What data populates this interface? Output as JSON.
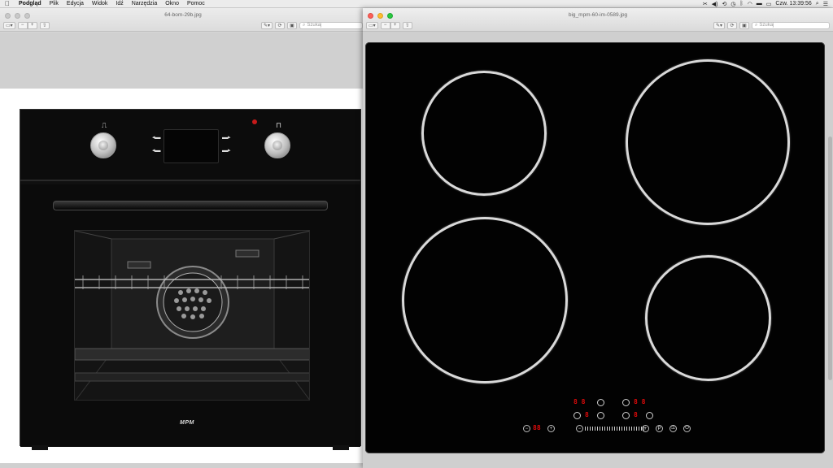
{
  "menubar": {
    "apple": "",
    "app": "Podgląd",
    "items": [
      "Plik",
      "Edycja",
      "Widok",
      "Idź",
      "Narzędzia",
      "Okno",
      "Pomoc"
    ],
    "clock": "Czw. 13:39:56"
  },
  "window1": {
    "title": "64-bom-29b.jpg",
    "search_placeholder": "Szukaj"
  },
  "window2": {
    "title": "big_mpm-60-im-0589.jpg",
    "search_placeholder": "Szukaj"
  },
  "oven": {
    "brand": "MPM"
  },
  "hob": {
    "display_top_left": "8 8",
    "display_top_right": "8 8",
    "display_mid_left": "8",
    "display_mid_right": "8",
    "display_timer": "88"
  },
  "colors": {
    "menubar": "#ececec",
    "hob_glass": "#020202",
    "zone_ring": "#d9d9d9",
    "led_red": "#e10b0b"
  },
  "icons": {
    "apple": "apple-icon",
    "bluetooth": "bluetooth-icon",
    "wifi": "wifi-icon",
    "battery": "battery-icon",
    "search": "search-icon",
    "list": "list-icon"
  }
}
